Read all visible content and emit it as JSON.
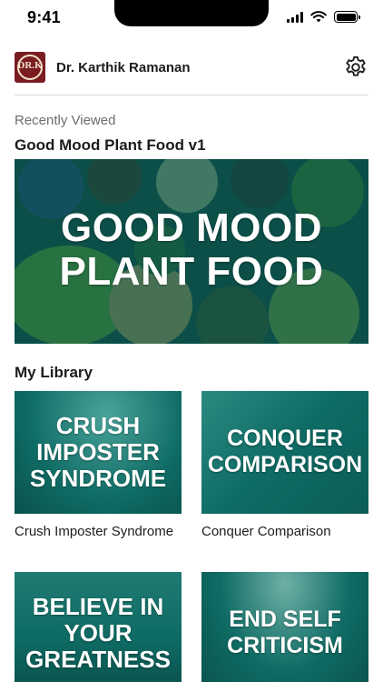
{
  "status_bar": {
    "time": "9:41"
  },
  "header": {
    "user_name": "Dr. Karthik Ramanan",
    "avatar_monogram": "DR.K"
  },
  "recently_viewed": {
    "label": "Recently Viewed",
    "title": "Good Mood Plant Food v1",
    "hero_line1": "GOOD MOOD",
    "hero_line2": "PLANT FOOD"
  },
  "library": {
    "title": "My Library",
    "items": [
      {
        "thumb_lines": [
          "CRUSH",
          "IMPOSTER",
          "SYNDROME"
        ],
        "label": "Crush Imposter Syndrome"
      },
      {
        "thumb_lines": [
          "CONQUER",
          "COMPARISON"
        ],
        "label": "Conquer Comparison"
      },
      {
        "thumb_lines": [
          "BELIEVE IN",
          "YOUR",
          "GREATNESS"
        ],
        "label": ""
      },
      {
        "thumb_lines": [
          "END SELF",
          "CRITICISM"
        ],
        "label": ""
      }
    ]
  },
  "colors": {
    "teal_overlay": "#0e6b64",
    "avatar_bg": "#7a1d22"
  }
}
